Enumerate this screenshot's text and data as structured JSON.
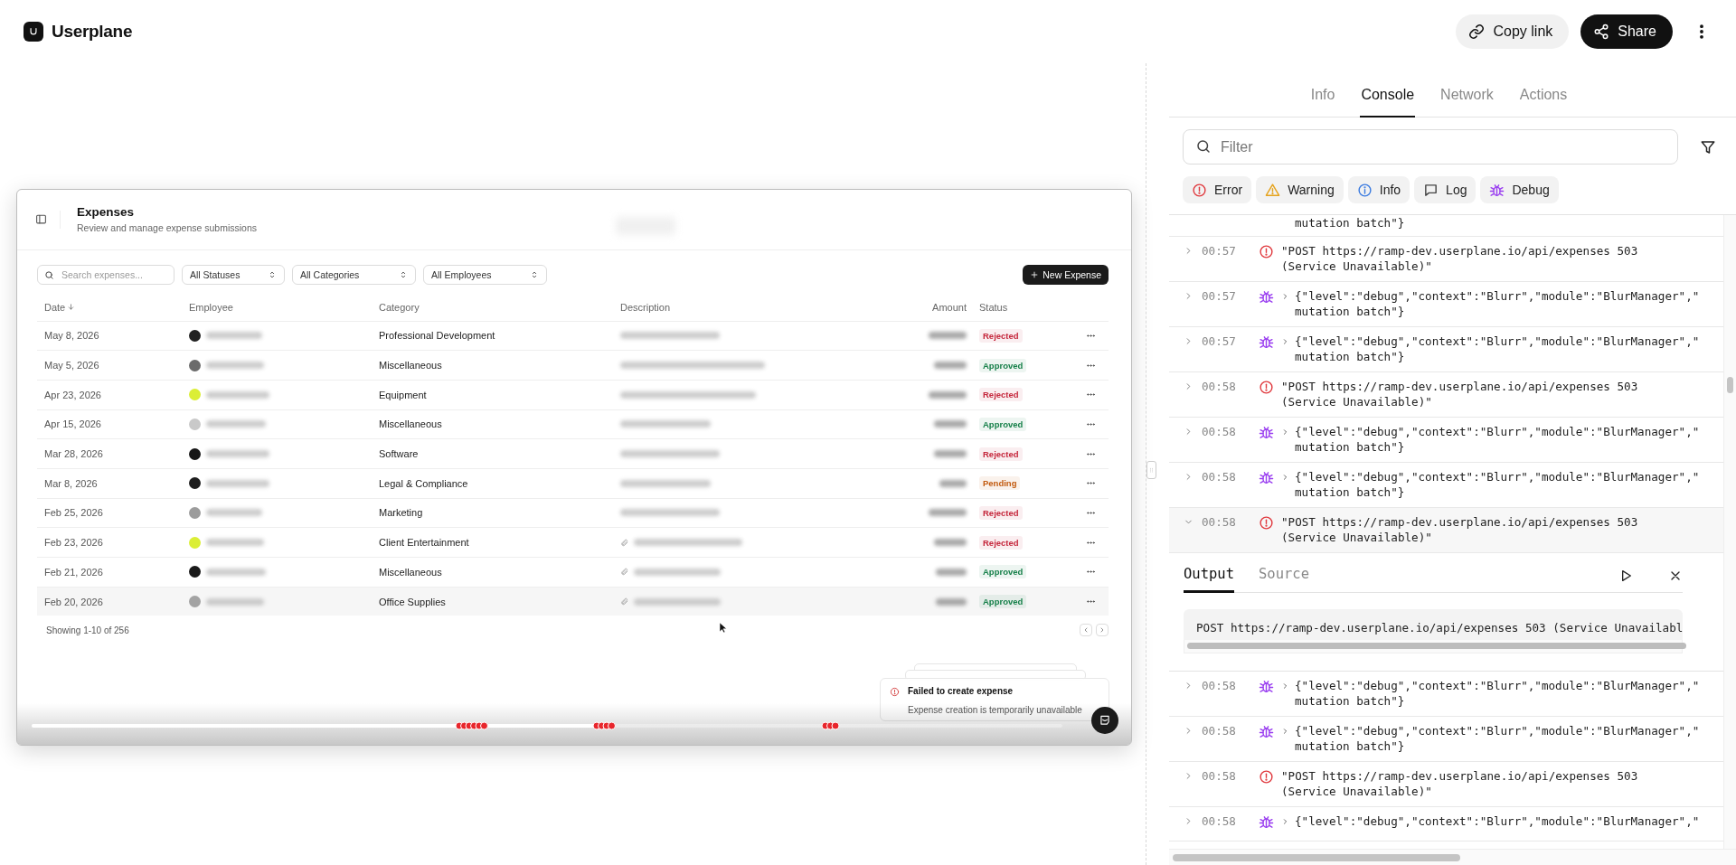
{
  "app": {
    "name": "Userplane"
  },
  "header_actions": {
    "copy_link": "Copy link",
    "share": "Share"
  },
  "replay": {
    "page": {
      "title": "Expenses",
      "subtitle": "Review and manage expense submissions"
    },
    "search": {
      "placeholder": "Search expenses..."
    },
    "filters": [
      "All Statuses",
      "All Categories",
      "All Employees"
    ],
    "new_button": "New Expense",
    "columns": [
      {
        "label": "Date",
        "sorted": true
      },
      {
        "label": "Employee",
        "sorted": false
      },
      {
        "label": "Category",
        "sorted": false
      },
      {
        "label": "Description",
        "sorted": false
      },
      {
        "label": "Amount",
        "sorted": false
      },
      {
        "label": "Status",
        "sorted": false
      }
    ],
    "rows": [
      {
        "date": "May 8, 2026",
        "color": "#222222",
        "category": "Professional Development",
        "attachment": false,
        "status": {
          "label": "Rejected",
          "color": "#c5283d"
        },
        "hovered": false
      },
      {
        "date": "May 5, 2026",
        "color": "#6b6b6b",
        "category": "Miscellaneous",
        "attachment": false,
        "status": {
          "label": "Approved",
          "color": "#17804a"
        },
        "hovered": false
      },
      {
        "date": "Apr 23, 2026",
        "color": "#dbee36",
        "category": "Equipment",
        "attachment": false,
        "status": {
          "label": "Rejected",
          "color": "#c5283d"
        },
        "hovered": false
      },
      {
        "date": "Apr 15, 2026",
        "color": "#c9c9c9",
        "category": "Miscellaneous",
        "attachment": false,
        "status": {
          "label": "Approved",
          "color": "#17804a"
        },
        "hovered": false
      },
      {
        "date": "Mar 28, 2026",
        "color": "#161616",
        "category": "Software",
        "attachment": false,
        "status": {
          "label": "Rejected",
          "color": "#c5283d"
        },
        "hovered": false
      },
      {
        "date": "Mar 8, 2026",
        "color": "#1e1e1e",
        "category": "Legal & Compliance",
        "attachment": false,
        "status": {
          "label": "Pending",
          "color": "#c25a0e"
        },
        "hovered": false
      },
      {
        "date": "Feb 25, 2026",
        "color": "#9c9c9c",
        "category": "Marketing",
        "attachment": false,
        "status": {
          "label": "Rejected",
          "color": "#c5283d"
        },
        "hovered": false
      },
      {
        "date": "Feb 23, 2026",
        "color": "#dbee36",
        "category": "Client Entertainment",
        "attachment": true,
        "status": {
          "label": "Rejected",
          "color": "#c5283d"
        },
        "hovered": false
      },
      {
        "date": "Feb 21, 2026",
        "color": "#1a1a1a",
        "category": "Miscellaneous",
        "attachment": true,
        "status": {
          "label": "Approved",
          "color": "#17804a"
        },
        "hovered": false
      },
      {
        "date": "Feb 20, 2026",
        "color": "#a3a3a3",
        "category": "Office Supplies",
        "attachment": true,
        "status": {
          "label": "Approved",
          "color": "#17804a"
        },
        "hovered": true
      }
    ],
    "footer": "Showing 1-10 of 256",
    "toast": {
      "title": "Failed to create expense",
      "message": "Expense creation is temporarily unavailable"
    },
    "timeline": {
      "level": 0.56
    }
  },
  "panel": {
    "tabs": [
      {
        "label": "Info",
        "selected": false
      },
      {
        "label": "Console",
        "selected": true
      },
      {
        "label": "Network",
        "selected": false
      },
      {
        "label": "Actions",
        "selected": false
      }
    ],
    "filter": {
      "placeholder": "Filter"
    },
    "levels": [
      {
        "label": "Error",
        "kind": "error"
      },
      {
        "label": "Warning",
        "kind": "warning"
      },
      {
        "label": "Info",
        "kind": "info"
      },
      {
        "label": "Log",
        "kind": "log"
      },
      {
        "label": "Debug",
        "kind": "debug"
      }
    ],
    "logs": [
      {
        "kind": "continuation",
        "message_end": "mutation batch\"}"
      },
      {
        "time": "00:57",
        "kind": "error",
        "expanded": false,
        "message": "\"POST https://ramp-dev.userplane.io/api/expenses 503 (Service Unavailable)\""
      },
      {
        "time": "00:57",
        "kind": "debug",
        "expanded": false,
        "message": "{\"level\":\"debug\",\"context\":\"Blurr\",\"module\":\"BlurManager\",\"",
        "message_end": "mutation batch\"}"
      },
      {
        "time": "00:57",
        "kind": "debug",
        "expanded": false,
        "message": "{\"level\":\"debug\",\"context\":\"Blurr\",\"module\":\"BlurManager\",\"",
        "message_end": "mutation batch\"}"
      },
      {
        "time": "00:58",
        "kind": "error",
        "expanded": false,
        "message": "\"POST https://ramp-dev.userplane.io/api/expenses 503 (Service Unavailable)\""
      },
      {
        "time": "00:58",
        "kind": "debug",
        "expanded": false,
        "message": "{\"level\":\"debug\",\"context\":\"Blurr\",\"module\":\"BlurManager\",\"",
        "message_end": "mutation batch\"}"
      },
      {
        "time": "00:58",
        "kind": "debug",
        "expanded": false,
        "message": "{\"level\":\"debug\",\"context\":\"Blurr\",\"module\":\"BlurManager\",\"",
        "message_end": "mutation batch\"}"
      },
      {
        "time": "00:58",
        "kind": "error",
        "expanded": true,
        "message": "\"POST https://ramp-dev.userplane.io/api/expenses 503 (Service Unavailable)\"",
        "detail": {
          "tabs": [
            {
              "label": "Output",
              "selected": true
            },
            {
              "label": "Source",
              "selected": false
            }
          ],
          "output": "POST https://ramp-dev.userplane.io/api/expenses 503 (Service Unavailabl"
        }
      },
      {
        "time": "00:58",
        "kind": "debug",
        "expanded": false,
        "message": "{\"level\":\"debug\",\"context\":\"Blurr\",\"module\":\"BlurManager\",\"",
        "message_end": "mutation batch\"}"
      },
      {
        "time": "00:58",
        "kind": "debug",
        "expanded": false,
        "message": "{\"level\":\"debug\",\"context\":\"Blurr\",\"module\":\"BlurManager\",\"",
        "message_end": "mutation batch\"}"
      },
      {
        "time": "00:58",
        "kind": "error",
        "expanded": false,
        "message": "\"POST https://ramp-dev.userplane.io/api/expenses 503 (Service Unavailable)\""
      },
      {
        "time": "00:58",
        "kind": "debug",
        "expanded": false,
        "message": "{\"level\":\"debug\",\"context\":\"Blurr\",\"module\":\"BlurManager\",\""
      }
    ]
  }
}
